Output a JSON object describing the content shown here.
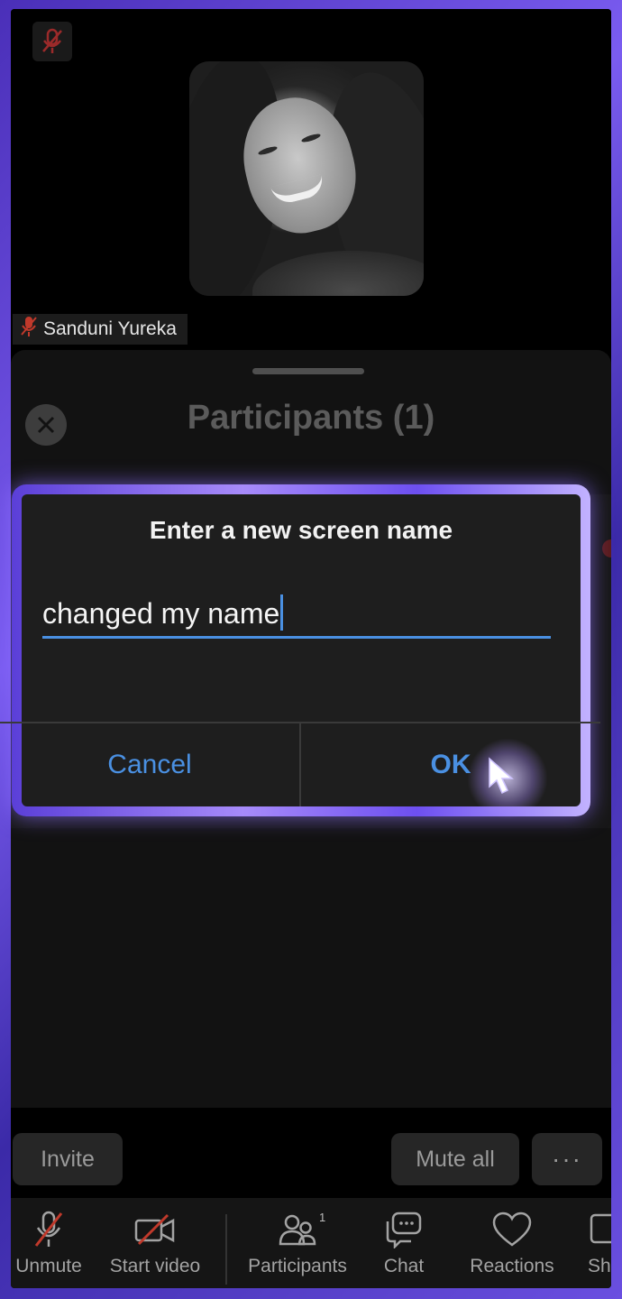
{
  "video": {
    "participant_name": "Sanduni Yureka"
  },
  "sheet": {
    "title": "Participants (1)"
  },
  "dialog": {
    "title": "Enter a new screen name",
    "input_value": "changed my name",
    "cancel_label": "Cancel",
    "ok_label": "OK"
  },
  "actions": {
    "invite_label": "Invite",
    "mute_all_label": "Mute all",
    "more_label": "···"
  },
  "toolbar": {
    "unmute_label": "Unmute",
    "start_video_label": "Start video",
    "participants_label": "Participants",
    "participants_count": "1",
    "chat_label": "Chat",
    "reactions_label": "Reactions",
    "share_label": "Sh"
  },
  "colors": {
    "accent": "#4a90e2",
    "muted_red": "#c0392b",
    "frame_purple": "#6a4fe0"
  }
}
